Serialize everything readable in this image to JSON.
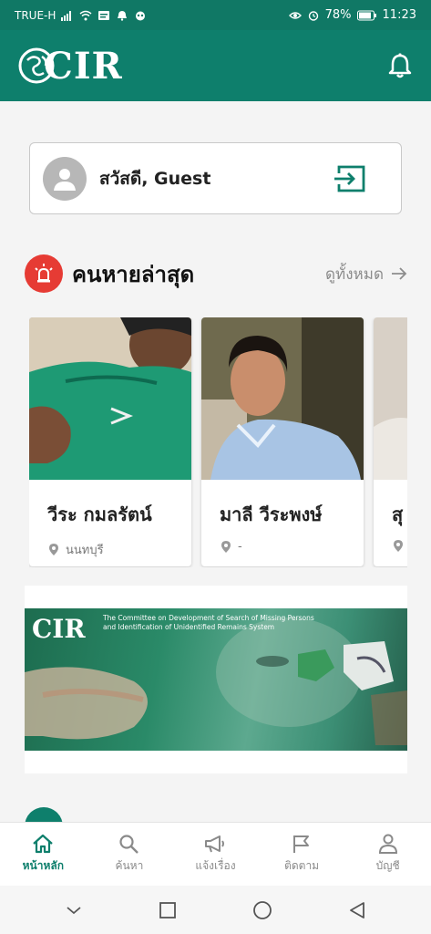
{
  "status_bar": {
    "carrier": "TRUE-H",
    "battery": "78%",
    "time": "11:23"
  },
  "header": {
    "logo_text": "CIR"
  },
  "greeting": {
    "text": "สวัสดี, Guest"
  },
  "latest_missing": {
    "title": "คนหายล่าสุด",
    "see_all": "ดูทั้งหมด",
    "people": [
      {
        "name": "วีระ กมลรัตน์",
        "location": "นนทบุรี"
      },
      {
        "name": "มาลี วีระพงษ์",
        "location": "-"
      },
      {
        "name": "สุ",
        "location": ""
      }
    ]
  },
  "banner": {
    "logo": "CIR",
    "caption_line1": "The Committee on Development of Search of Missing Persons",
    "caption_line2": "and Identification of Unidentified Remains System"
  },
  "bottom_nav": [
    {
      "label": "หน้าหลัก",
      "icon": "home-icon",
      "active": true
    },
    {
      "label": "ค้นหา",
      "icon": "search-icon",
      "active": false
    },
    {
      "label": "แจ้งเรื่อง",
      "icon": "megaphone-icon",
      "active": false
    },
    {
      "label": "ติดตาม",
      "icon": "flag-icon",
      "active": false
    },
    {
      "label": "บัญชี",
      "icon": "user-icon",
      "active": false
    }
  ],
  "colors": {
    "primary": "#0e7f6c",
    "alert": "#e63b34"
  }
}
